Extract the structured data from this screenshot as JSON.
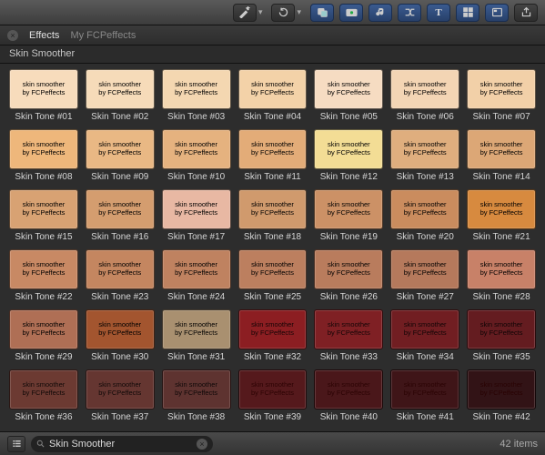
{
  "toolbar": {
    "buttons": [
      {
        "name": "enhancements-menu",
        "icon": "wand"
      },
      {
        "name": "retiming-menu",
        "icon": "retime"
      },
      {
        "name": "media-browser",
        "icon": "media",
        "group": true
      },
      {
        "name": "photos-browser",
        "icon": "camera",
        "group": true
      },
      {
        "name": "music-browser",
        "icon": "music",
        "group": true
      },
      {
        "name": "transitions-browser",
        "icon": "transitions",
        "group": true
      },
      {
        "name": "titles-browser",
        "icon": "titles",
        "group": true
      },
      {
        "name": "generators-browser",
        "icon": "generators",
        "group": true
      },
      {
        "name": "themes-browser",
        "icon": "themes",
        "group": true
      },
      {
        "name": "share-button",
        "icon": "share"
      }
    ]
  },
  "tabs": {
    "close_label": "×",
    "items": [
      {
        "label": "Effects",
        "active": true
      },
      {
        "label": "My FCPeffects",
        "active": false
      }
    ]
  },
  "category": "Skin Smoother",
  "swatch_text": {
    "line1": "skin smoother",
    "line2": "by FCPeffects"
  },
  "items": [
    {
      "n": 1,
      "label": "Skin Tone #01",
      "c": "#f7dcbc"
    },
    {
      "n": 2,
      "label": "Skin Tone #02",
      "c": "#f6dbb9"
    },
    {
      "n": 3,
      "label": "Skin Tone #03",
      "c": "#f4d7b1"
    },
    {
      "n": 4,
      "label": "Skin Tone #04",
      "c": "#f3d2a8"
    },
    {
      "n": 5,
      "label": "Skin Tone #05",
      "c": "#f6dcc2"
    },
    {
      "n": 6,
      "label": "Skin Tone #06",
      "c": "#f3d5b4"
    },
    {
      "n": 7,
      "label": "Skin Tone #07",
      "c": "#f2d0a8"
    },
    {
      "n": 8,
      "label": "Skin Tone #08",
      "c": "#eeb77b"
    },
    {
      "n": 9,
      "label": "Skin Tone #09",
      "c": "#e9b884"
    },
    {
      "n": 10,
      "label": "Skin Tone #10",
      "c": "#e5b27f"
    },
    {
      "n": 11,
      "label": "Skin Tone #11",
      "c": "#e3ac78"
    },
    {
      "n": 12,
      "label": "Skin Tone #12",
      "c": "#f3dd95"
    },
    {
      "n": 13,
      "label": "Skin Tone #13",
      "c": "#dfae7e"
    },
    {
      "n": 14,
      "label": "Skin Tone #14",
      "c": "#dca776"
    },
    {
      "n": 15,
      "label": "Skin Tone #15",
      "c": "#d8a273"
    },
    {
      "n": 16,
      "label": "Skin Tone #16",
      "c": "#d49d6f"
    },
    {
      "n": 17,
      "label": "Skin Tone #17",
      "c": "#e8b8a3"
    },
    {
      "n": 18,
      "label": "Skin Tone #18",
      "c": "#d09a6d"
    },
    {
      "n": 19,
      "label": "Skin Tone #19",
      "c": "#cc9166"
    },
    {
      "n": 20,
      "label": "Skin Tone #20",
      "c": "#ca8c5e"
    },
    {
      "n": 21,
      "label": "Skin Tone #21",
      "c": "#d78a3f"
    },
    {
      "n": 22,
      "label": "Skin Tone #22",
      "c": "#c88964"
    },
    {
      "n": 23,
      "label": "Skin Tone #23",
      "c": "#c48660"
    },
    {
      "n": 24,
      "label": "Skin Tone #24",
      "c": "#bf8260"
    },
    {
      "n": 25,
      "label": "Skin Tone #25",
      "c": "#bc7f5f"
    },
    {
      "n": 26,
      "label": "Skin Tone #26",
      "c": "#b97c5d"
    },
    {
      "n": 27,
      "label": "Skin Tone #27",
      "c": "#b5795c"
    },
    {
      "n": 28,
      "label": "Skin Tone #28",
      "c": "#c88168"
    },
    {
      "n": 29,
      "label": "Skin Tone #29",
      "c": "#af6f55"
    },
    {
      "n": 30,
      "label": "Skin Tone #30",
      "c": "#a3552f"
    },
    {
      "n": 31,
      "label": "Skin Tone #31",
      "c": "#a99070"
    },
    {
      "n": 32,
      "label": "Skin Tone #32",
      "c": "#8c1e22",
      "dark": true
    },
    {
      "n": 33,
      "label": "Skin Tone #33",
      "c": "#7f2024",
      "dark": true
    },
    {
      "n": 34,
      "label": "Skin Tone #34",
      "c": "#711e22",
      "dark": true
    },
    {
      "n": 35,
      "label": "Skin Tone #35",
      "c": "#641c20",
      "dark": true
    },
    {
      "n": 36,
      "label": "Skin Tone #36",
      "c": "#6c3a32",
      "dark": true
    },
    {
      "n": 37,
      "label": "Skin Tone #37",
      "c": "#653631",
      "dark": true
    },
    {
      "n": 38,
      "label": "Skin Tone #38",
      "c": "#5e3330",
      "dark": true
    },
    {
      "n": 39,
      "label": "Skin Tone #39",
      "c": "#55191c",
      "vdark": true
    },
    {
      "n": 40,
      "label": "Skin Tone #40",
      "c": "#4a171a",
      "vdark": true
    },
    {
      "n": 41,
      "label": "Skin Tone #41",
      "c": "#3f1518",
      "vdark": true
    },
    {
      "n": 42,
      "label": "Skin Tone #42",
      "c": "#321316",
      "vdark": true
    }
  ],
  "footer": {
    "list_view_label": "list-view",
    "search_value": "Skin Smoother",
    "clear_label": "×",
    "count": "42 items"
  }
}
